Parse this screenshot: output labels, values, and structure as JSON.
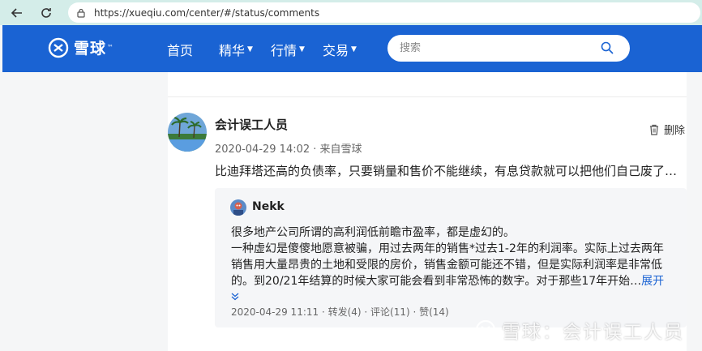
{
  "browser": {
    "url": "https://xueqiu.com/center/#/status/comments"
  },
  "header": {
    "logo": "雪球",
    "tm": "™",
    "nav": [
      {
        "label": "首页",
        "caret": ""
      },
      {
        "label": "精华",
        "caret": "▼"
      },
      {
        "label": "行情",
        "caret": "▼"
      },
      {
        "label": "交易",
        "caret": "▼"
      }
    ],
    "search_placeholder": "搜索"
  },
  "post": {
    "username": "会计误工人员",
    "meta": "2020-04-29 14:02 · 来自雪球",
    "delete_label": "删除",
    "content": "比迪拜塔还高的负债率，只要销量和售价不能继续，有息贷款就可以把他们自己废了…",
    "quote": {
      "username": "Nekk",
      "lines": [
        "很多地产公司所谓的高利润低前瞻市盈率，都是虚幻的。",
        "一种虚幻是傻傻地愿意被骗，用过去两年的销售*过去1-2年的利润率。实际上过去两年",
        "销售用大量昂贵的土地和受限的房价，销售金额可能还不错，但是实际利润率是非常低",
        "的。到20/21年结算的时候大家可能会看到非常恐怖的数字。对于那些17年开始…"
      ],
      "expand_label": "展开",
      "footer": "2020-04-29 11:11 · 转发(4) · 评论(11) · 赞(14)"
    }
  },
  "watermark": "雪球：会计误工人员"
}
